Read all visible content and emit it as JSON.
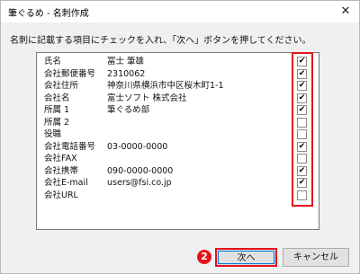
{
  "window": {
    "title": "筆ぐるめ - 名刺作成",
    "close_glyph": "✕"
  },
  "instruction": "名刺に記載する項目にチェックを入れ、「次へ」ボタンを押してください。",
  "fields": [
    {
      "label": "氏名",
      "value": "冨士 筆雄",
      "checked": true
    },
    {
      "label": "会社郵便番号",
      "value": "2310062",
      "checked": true
    },
    {
      "label": "会社住所",
      "value": "神奈川県横浜市中区桜木町1-1",
      "checked": true
    },
    {
      "label": "会社名",
      "value": "富士ソフト 株式会社",
      "checked": true
    },
    {
      "label": "所属 1",
      "value": "筆ぐるめ部",
      "checked": true
    },
    {
      "label": "所属 2",
      "value": "",
      "checked": false
    },
    {
      "label": "役職",
      "value": "",
      "checked": false
    },
    {
      "label": "会社電話番号",
      "value": "03-0000-0000",
      "checked": true
    },
    {
      "label": "会社FAX",
      "value": "",
      "checked": false
    },
    {
      "label": "会社携帯",
      "value": "090-0000-0000",
      "checked": true
    },
    {
      "label": "会社E-mail",
      "value": "users@fsi.co.jp",
      "checked": true
    },
    {
      "label": "会社URL",
      "value": "",
      "checked": false
    }
  ],
  "buttons": {
    "next": "次へ",
    "cancel": "キャンセル"
  },
  "step_badge": "2",
  "colors": {
    "highlight": "#e4131b",
    "focus": "#0078d7"
  }
}
